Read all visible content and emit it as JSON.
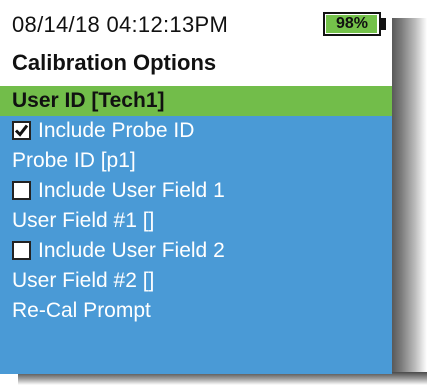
{
  "status": {
    "datetime": "08/14/18 04:12:13PM",
    "battery_percent": 98,
    "battery_label": "98%"
  },
  "screen": {
    "title": "Calibration Options"
  },
  "menu": {
    "items": [
      {
        "label": "User ID [Tech1]",
        "selected": true
      },
      {
        "label": "Include Probe ID",
        "checkbox": true,
        "checked": true
      },
      {
        "label": "Probe ID [p1]"
      },
      {
        "label": "Include User Field 1",
        "checkbox": true,
        "checked": false
      },
      {
        "label": "User Field #1 []"
      },
      {
        "label": "Include User Field 2",
        "checkbox": true,
        "checked": false
      },
      {
        "label": "User Field #2 []"
      },
      {
        "label": "Re-Cal Prompt"
      }
    ]
  },
  "colors": {
    "screen_background": "#4a9ad6",
    "selection_highlight": "#72bd4a",
    "battery_fill": "#74c24a"
  }
}
